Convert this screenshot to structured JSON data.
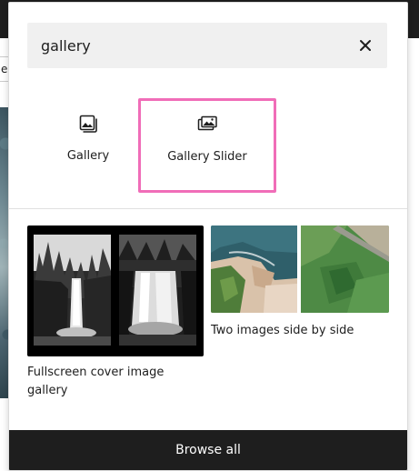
{
  "search": {
    "value": "gallery",
    "clear_icon": "close-icon"
  },
  "blocks": [
    {
      "label": "Gallery",
      "icon": "gallery-icon"
    },
    {
      "label": "Gallery Slider",
      "icon": "gallery-slider-icon",
      "highlighted": true,
      "highlight_color": "#f06db8"
    }
  ],
  "patterns": [
    {
      "label": "Fullscreen cover image gallery",
      "thumbnail": "black-and-white waterfall photos"
    },
    {
      "label": "Two images side by side",
      "thumbnail": "aerial coastline and green fields photos"
    }
  ],
  "footer": {
    "browse_all_label": "Browse all"
  },
  "background": {
    "left_stub_char": "e"
  },
  "colors": {
    "highlight": "#f06db8",
    "footer_bg": "#1e1e1e",
    "search_bg": "#f0f0f0",
    "text": "#1e1e1e"
  }
}
